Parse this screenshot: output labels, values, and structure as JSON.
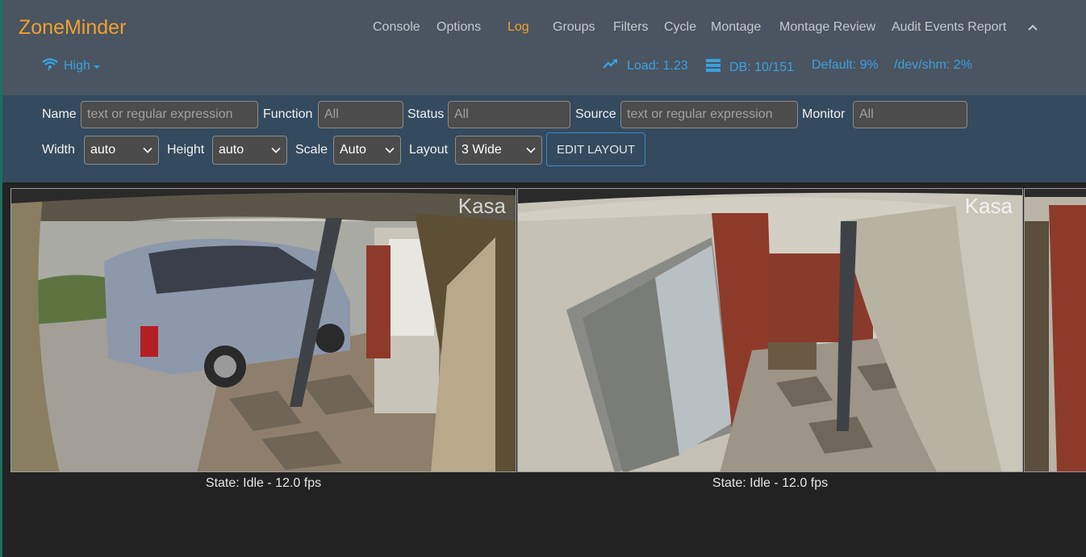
{
  "brand": "ZoneMinder",
  "nav": {
    "items": [
      {
        "label": "Console"
      },
      {
        "label": "Options"
      },
      {
        "label": "Log",
        "active": true
      },
      {
        "label": "Groups"
      },
      {
        "label": "Filters"
      },
      {
        "label": "Cycle"
      },
      {
        "label": "Montage"
      },
      {
        "label": "Montage Review"
      },
      {
        "label": "Audit Events Report"
      }
    ]
  },
  "bandwidth": "High",
  "status": {
    "load": "Load: 1.23",
    "db": "DB: 10/151",
    "default": "Default: 9%",
    "shm": "/dev/shm: 2%"
  },
  "filters": {
    "name_label": "Name",
    "name_placeholder": "text or regular expression",
    "function_label": "Function",
    "function_placeholder": "All",
    "status_label": "Status",
    "status_placeholder": "All",
    "source_label": "Source",
    "source_placeholder": "text or regular expression",
    "monitor_label": "Monitor",
    "monitor_placeholder": "All"
  },
  "layout_controls": {
    "width_label": "Width",
    "width_value": "auto",
    "height_label": "Height",
    "height_value": "auto",
    "scale_label": "Scale",
    "scale_value": "Auto",
    "layout_label": "Layout",
    "layout_value": "3 Wide",
    "edit_button": "EDIT LAYOUT"
  },
  "monitors": [
    {
      "watermark": "Kasa",
      "state": "State: Idle - 12.0 fps"
    },
    {
      "watermark": "Kasa",
      "state": "State: Idle - 12.0 fps"
    }
  ],
  "colors": {
    "accent": "#f0a030",
    "link": "#3aa0e0",
    "topbar": "#4a5561",
    "filterbar": "#344a5e"
  }
}
